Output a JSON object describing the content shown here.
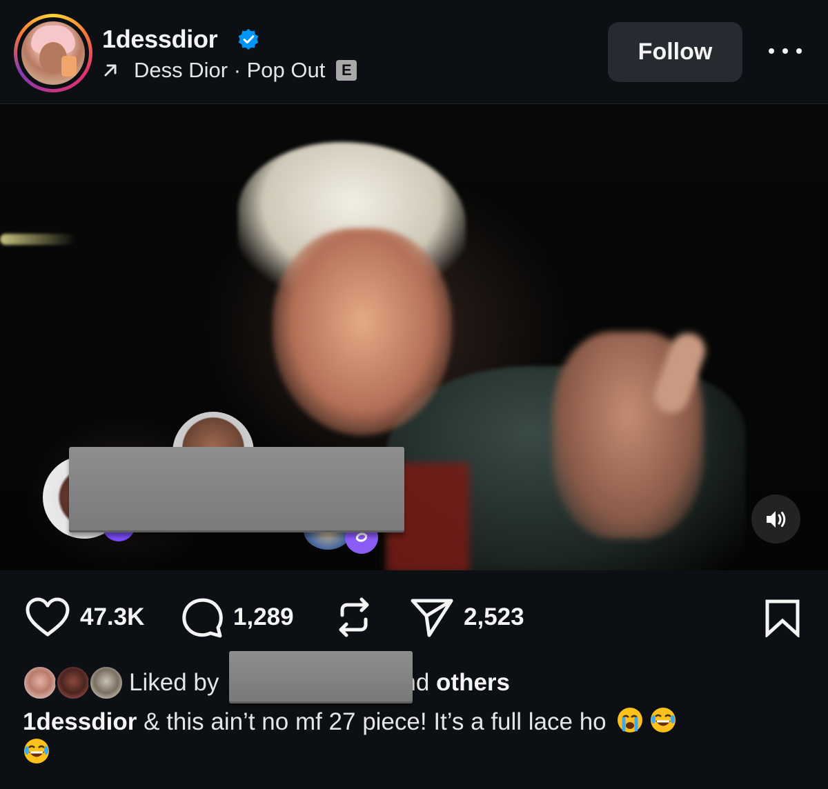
{
  "header": {
    "username": "1dessdior",
    "music_artist_track": "Dess Dior · Pop Out",
    "explicit_label": "E",
    "follow_label": "Follow"
  },
  "actions": {
    "likes_count": "47.3K",
    "comments_count": "1,289",
    "shares_count": "2,523"
  },
  "likes": {
    "prefix": "Liked by",
    "suffix": "nd",
    "others": "others"
  },
  "caption": {
    "username": "1dessdior",
    "text": "& this ain’t no mf 27 piece! It’s a full lace ho"
  },
  "colors": {
    "background": "#0c1014",
    "follow_button_bg": "#262b31",
    "verified_blue": "#0095f6",
    "accent_purple": "#8b5cf6"
  },
  "icons": [
    "verified-badge-icon",
    "arrow-up-right-icon",
    "more-icon",
    "volume-icon",
    "heart-icon",
    "comment-icon",
    "repost-icon",
    "share-icon",
    "bookmark-icon",
    "crying-emoji-icon",
    "laughing-emoji-icon"
  ]
}
